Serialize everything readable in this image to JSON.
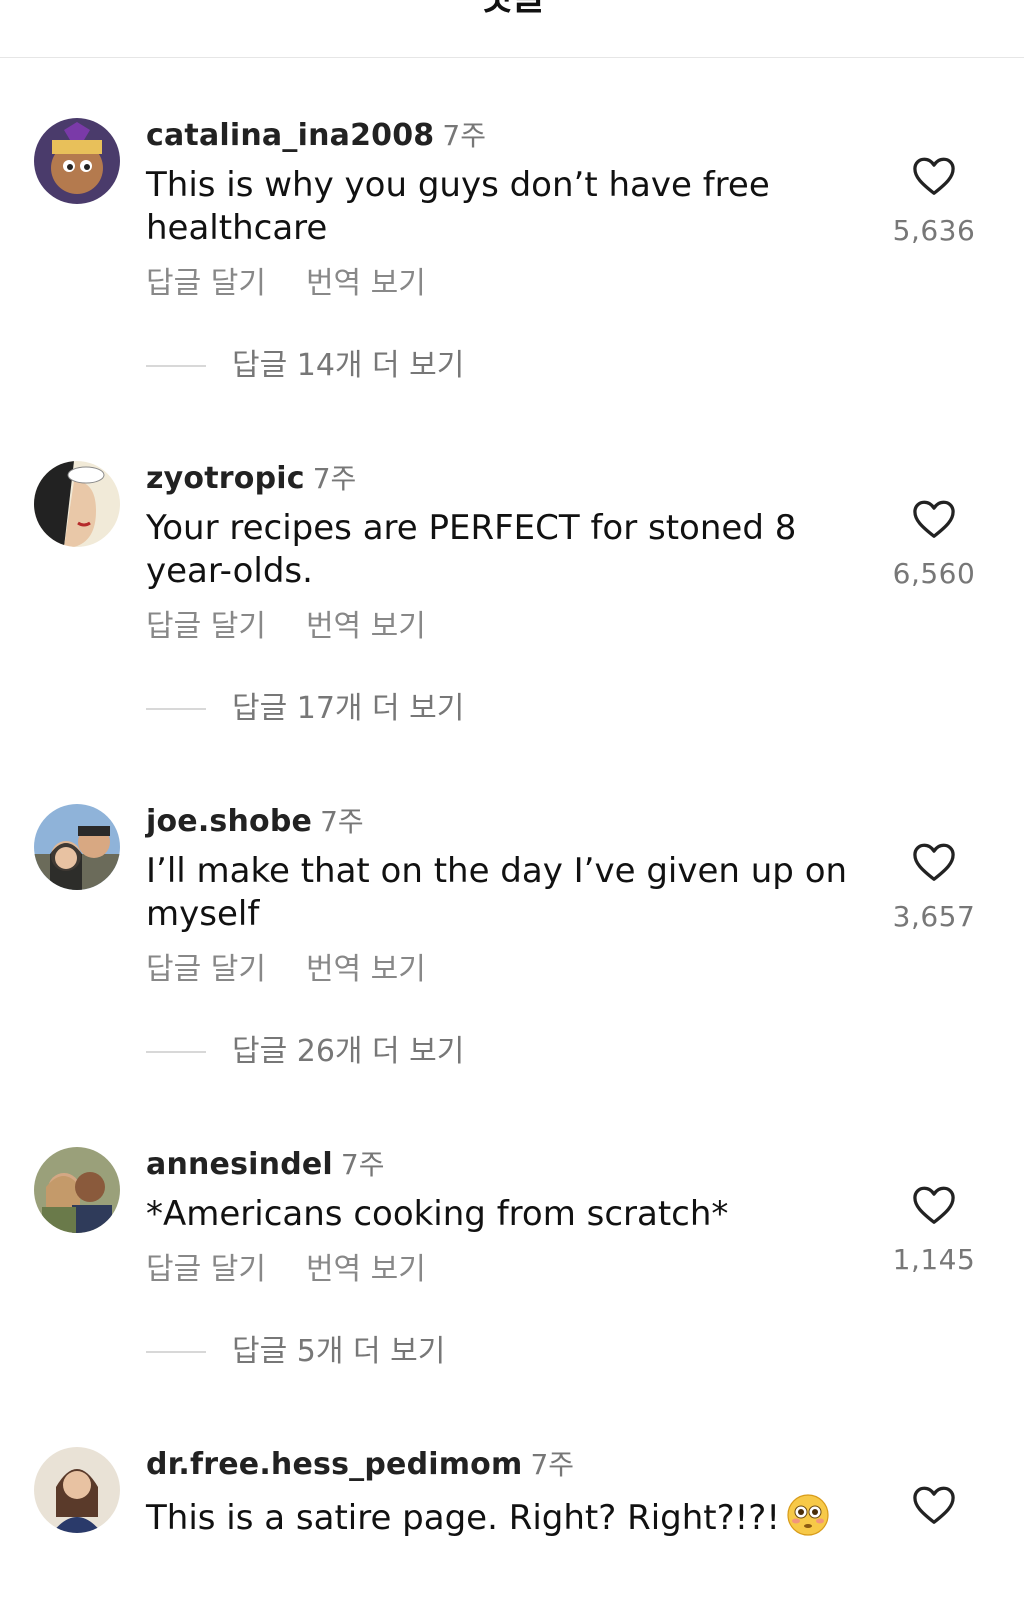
{
  "header": {
    "title": "댓글"
  },
  "comments": [
    {
      "username": "catalina_ina2008",
      "time": "7주",
      "text": "This is why you guys don’t have free healthcare",
      "reply_label": "답글 달기",
      "translate_label": "번역 보기",
      "view_replies": "답글 14개 더 보기",
      "likes": "5,636"
    },
    {
      "username": "zyotropic",
      "time": "7주",
      "text": "Your recipes are PERFECT for stoned 8 year-olds.",
      "reply_label": "답글 달기",
      "translate_label": "번역 보기",
      "view_replies": "답글 17개 더 보기",
      "likes": "6,560"
    },
    {
      "username": "joe.shobe",
      "time": "7주",
      "text": "I’ll make that on the day I’ve given up on myself",
      "reply_label": "답글 달기",
      "translate_label": "번역 보기",
      "view_replies": "답글 26개 더 보기",
      "likes": "3,657"
    },
    {
      "username": "annesindel",
      "time": "7주",
      "text": "*Americans cooking from scratch*",
      "reply_label": "답글 달기",
      "translate_label": "번역 보기",
      "view_replies": "답글 5개 더 보기",
      "likes": "1,145"
    },
    {
      "username": "dr.free.hess_pedimom",
      "time": "7주",
      "text": "This is a satire page. Right? Right?!?!",
      "emoji": "flushed-face-emoji"
    }
  ],
  "icons": {
    "like": "heart-outline-icon"
  },
  "colors": {
    "text": "#111111",
    "secondary": "#888888",
    "divider": "#e6e6e6"
  }
}
